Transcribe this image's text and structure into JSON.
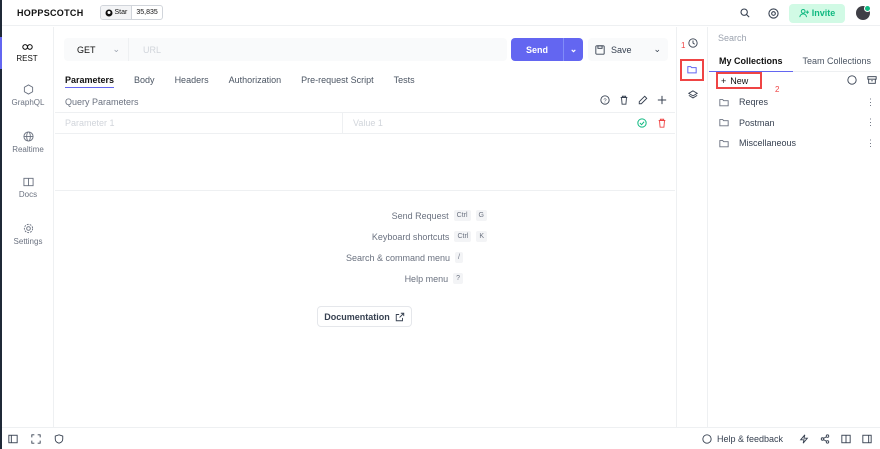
{
  "header": {
    "brand": "HOPPSCOTCH",
    "star_label": "Star",
    "star_count": "35,835",
    "invite_label": "Invite"
  },
  "sidebar": {
    "items": [
      {
        "label": "REST",
        "icon": "link-icon"
      },
      {
        "label": "GraphQL",
        "icon": "graphql-icon"
      },
      {
        "label": "Realtime",
        "icon": "globe-icon"
      },
      {
        "label": "Docs",
        "icon": "book-icon"
      },
      {
        "label": "Settings",
        "icon": "gear-icon"
      }
    ]
  },
  "request": {
    "method": "GET",
    "url_placeholder": "URL",
    "send_label": "Send",
    "save_label": "Save"
  },
  "tabs": [
    "Parameters",
    "Body",
    "Headers",
    "Authorization",
    "Pre-request Script",
    "Tests"
  ],
  "params": {
    "title": "Query Parameters",
    "key_placeholder": "Parameter 1",
    "value_placeholder": "Value 1"
  },
  "shortcuts": [
    {
      "label": "Send Request",
      "keys": [
        "Ctrl",
        "G"
      ]
    },
    {
      "label": "Keyboard shortcuts",
      "keys": [
        "Ctrl",
        "K"
      ]
    },
    {
      "label": "Search & command menu",
      "keys": [
        "/"
      ]
    },
    {
      "label": "Help menu",
      "keys": [
        "?"
      ]
    }
  ],
  "documentation_label": "Documentation",
  "collections": {
    "search_placeholder": "Search",
    "tabs": [
      "My Collections",
      "Team Collections"
    ],
    "new_label": "New",
    "items": [
      "Reqres",
      "Postman",
      "Miscellaneous"
    ]
  },
  "annotations": {
    "one": "1",
    "two": "2"
  },
  "footer": {
    "help_label": "Help & feedback"
  },
  "colors": {
    "accent": "#6366f1",
    "success": "#10b981",
    "danger": "#ef4444"
  }
}
